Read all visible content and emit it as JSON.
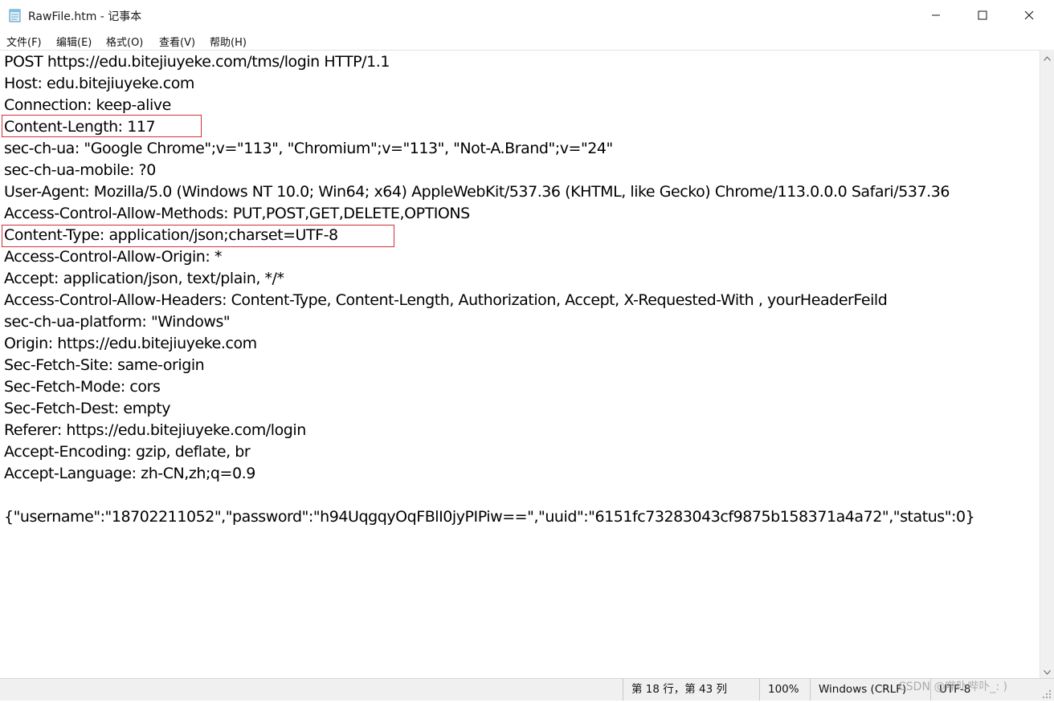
{
  "window": {
    "title": "RawFile.htm - 记事本",
    "icons": {
      "app": "notepad-icon",
      "minimize": "minimize-icon",
      "maximize": "maximize-icon",
      "close": "close-icon"
    }
  },
  "menu": [
    {
      "label": "文件(F)"
    },
    {
      "label": "编辑(E)"
    },
    {
      "label": "格式(O)"
    },
    {
      "label": "查看(V)"
    },
    {
      "label": "帮助(H)"
    }
  ],
  "document": {
    "lines": [
      "POST https://edu.bitejiuyeke.com/tms/login HTTP/1.1",
      "Host: edu.bitejiuyeke.com",
      "Connection: keep-alive",
      "Content-Length: 117",
      "sec-ch-ua: \"Google Chrome\";v=\"113\", \"Chromium\";v=\"113\", \"Not-A.Brand\";v=\"24\"",
      "sec-ch-ua-mobile: ?0",
      "User-Agent: Mozilla/5.0 (Windows NT 10.0; Win64; x64) AppleWebKit/537.36 (KHTML, like Gecko) Chrome/113.0.0.0 Safari/537.36",
      "Access-Control-Allow-Methods: PUT,POST,GET,DELETE,OPTIONS",
      "Content-Type: application/json;charset=UTF-8",
      "Access-Control-Allow-Origin: *",
      "Accept: application/json, text/plain, */*",
      "Access-Control-Allow-Headers: Content-Type, Content-Length, Authorization, Accept, X-Requested-With , yourHeaderFeild",
      "sec-ch-ua-platform: \"Windows\"",
      "Origin: https://edu.bitejiuyeke.com",
      "Sec-Fetch-Site: same-origin",
      "Sec-Fetch-Mode: cors",
      "Sec-Fetch-Dest: empty",
      "Referer: https://edu.bitejiuyeke.com/login",
      "Accept-Encoding: gzip, deflate, br",
      "Accept-Language: zh-CN,zh;q=0.9",
      "",
      "{\"username\":\"18702211052\",\"password\":\"h94UqgqyOqFBlI0jyPIPiw==\",\"uuid\":\"6151fc73283043cf9875b158371a4a72\",\"status\":0}"
    ],
    "highlighted_lines": [
      "Content-Length: 117",
      "Content-Type: application/json;charset=UTF-8"
    ],
    "highlight_color": "#d0303a"
  },
  "status": {
    "position": "第 18 行，第 43 列",
    "zoom": "100%",
    "line_ending": "Windows (CRLF)",
    "encoding": "UTF-8"
  },
  "watermark": "CSDN @哔卟哔卟_: )"
}
